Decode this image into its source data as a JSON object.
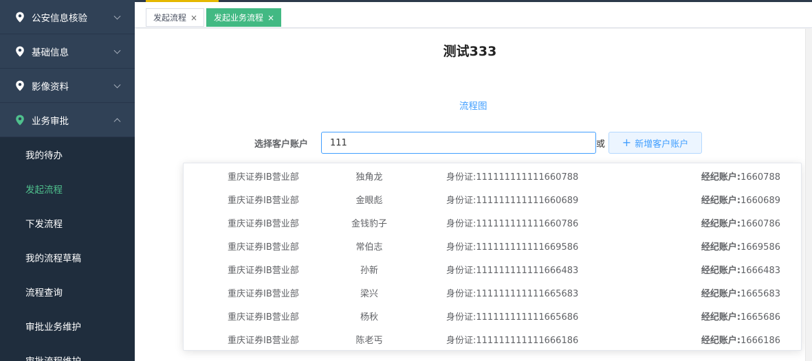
{
  "sidebar": {
    "groups": [
      {
        "label": "公安信息核验",
        "expanded": false
      },
      {
        "label": "基础信息",
        "expanded": false
      },
      {
        "label": "影像资料",
        "expanded": false
      },
      {
        "label": "业务审批",
        "expanded": true
      }
    ],
    "submenu": [
      {
        "label": "我的待办"
      },
      {
        "label": "发起流程",
        "current": true
      },
      {
        "label": "下发流程"
      },
      {
        "label": "我的流程草稿"
      },
      {
        "label": "流程查询"
      },
      {
        "label": "审批业务维护"
      },
      {
        "label": "审批流程维护"
      }
    ]
  },
  "tabs": [
    {
      "label": "发起流程",
      "active": false,
      "close": "×"
    },
    {
      "label": "发起业务流程",
      "active": true,
      "close": "×"
    }
  ],
  "main": {
    "title": "测试333",
    "flow_link": "流程图",
    "form_label": "选择客户账户",
    "input_value": "111",
    "or_text": "或",
    "add_button": "新增客户账户"
  },
  "dropdown": {
    "id_prefix": "身份证:",
    "account_prefix": "经纪账户:",
    "items": [
      {
        "dept": "重庆证券IB营业部",
        "name": "独角龙",
        "id": "111111111111660788",
        "account": "1660788"
      },
      {
        "dept": "重庆证券IB营业部",
        "name": "金眼彪",
        "id": "111111111111660689",
        "account": "1660689"
      },
      {
        "dept": "重庆证券IB营业部",
        "name": "金钱豹子",
        "id": "111111111111660786",
        "account": "1660786"
      },
      {
        "dept": "重庆证券IB营业部",
        "name": "常伯志",
        "id": "111111111111669586",
        "account": "1669586"
      },
      {
        "dept": "重庆证券IB营业部",
        "name": "孙新",
        "id": "111111111111666483",
        "account": "1666483"
      },
      {
        "dept": "重庆证券IB营业部",
        "name": "梁兴",
        "id": "111111111111665683",
        "account": "1665683"
      },
      {
        "dept": "重庆证券IB营业部",
        "name": "杨秋",
        "id": "111111111111665686",
        "account": "1665686"
      },
      {
        "dept": "重庆证券IB营业部",
        "name": "陈老丐",
        "id": "111111111111666186",
        "account": "1666186"
      }
    ]
  },
  "colors": {
    "sidebar_bg": "#304156",
    "submenu_bg": "#1f2d3d",
    "accent_green": "#42b983",
    "link_blue": "#409eff"
  }
}
